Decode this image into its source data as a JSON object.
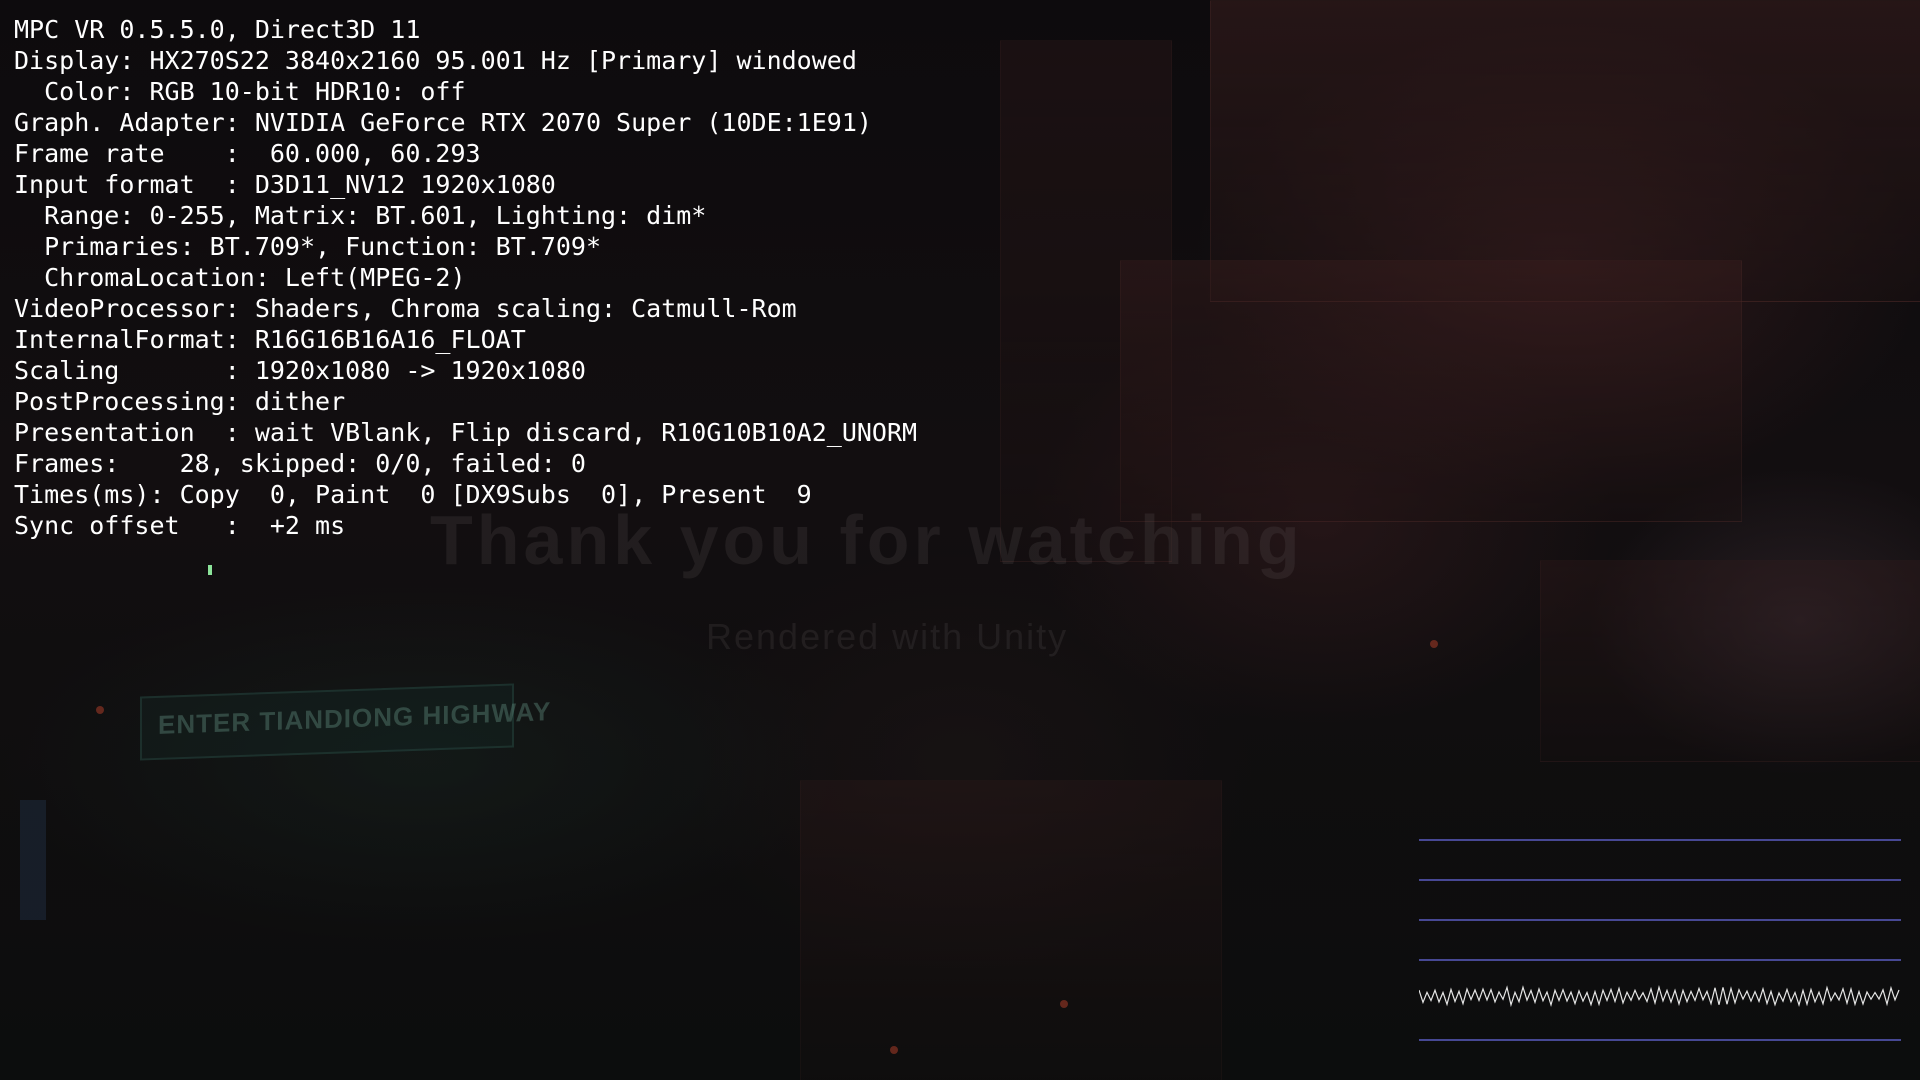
{
  "window": {
    "title": "MPC VR 0.5.5.0, Direct3D 11"
  },
  "background_frame": {
    "title_text": "Thank you for watching",
    "subtitle_text": "Rendered with Unity",
    "sign_text": "ENTER TIANDIONG HIGHWAY"
  },
  "stats": {
    "lines": [
      "MPC VR 0.5.5.0, Direct3D 11",
      "Display: HX270S22 3840x2160 95.001 Hz [Primary] windowed",
      "  Color: RGB 10-bit HDR10: off",
      "Graph. Adapter: NVIDIA GeForce RTX 2070 Super (10DE:1E91)",
      "Frame rate    :  60.000, 60.293",
      "Input format  : D3D11_NV12 1920x1080",
      "  Range: 0-255, Matrix: BT.601, Lighting: dim*",
      "  Primaries: BT.709*, Function: BT.709*",
      "  ChromaLocation: Left(MPEG-2)",
      "VideoProcessor: Shaders, Chroma scaling: Catmull-Rom",
      "InternalFormat: R16G16B16A16_FLOAT",
      "Scaling       : 1920x1080 -> 1920x1080",
      "PostProcessing: dither",
      "Presentation  : wait VBlank, Flip discard, R10G10B10A2_UNORM",
      "Frames:    28, skipped: 0/0, failed: 0",
      "Times(ms): Copy  0, Paint  0 [DX9Subs  0], Present  9",
      "Sync offset   :  +2 ms"
    ]
  },
  "sync_graph": {
    "gridline_color": "#5a5cc0",
    "trace_color": "#e6e6e6",
    "gridline_count": 6,
    "trace_row": 4
  },
  "colors": {
    "text": "#ffffff",
    "cursor": "#8ce39a"
  }
}
